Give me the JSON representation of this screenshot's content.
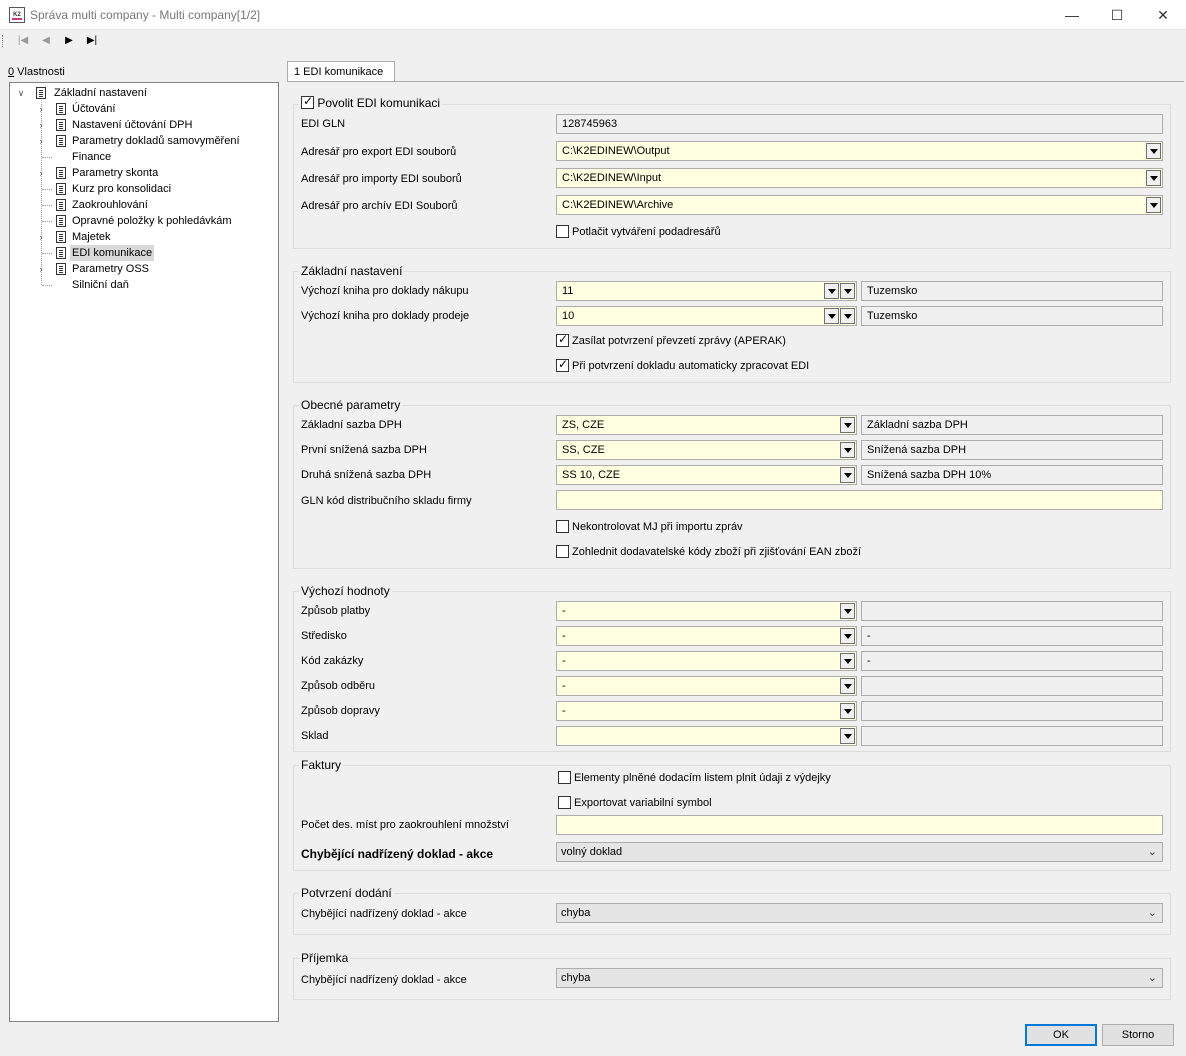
{
  "window": {
    "title": "Správa multi company - Multi company[1/2]",
    "app_icon_text": "K2"
  },
  "left": {
    "label_accel": "0",
    "label_rest": " Vlastnosti",
    "tree": {
      "root": "Základní nastavení",
      "items": [
        "Účtování",
        "Nastavení účtování DPH",
        "Parametry dokladů samovyměření",
        "Finance",
        "Parametry skonta",
        "Kurz pro konsolidaci",
        "Zaokrouhlování",
        "Opravné položky k pohledávkám",
        "Majetek",
        "EDI komunikace",
        "Parametry OSS",
        "Silniční daň"
      ]
    }
  },
  "tab": {
    "label": "1 EDI komunikace"
  },
  "edi": {
    "enable_label": "Povolit EDI komunikaci",
    "gln_label": "EDI GLN",
    "gln_value": "128745963",
    "export_label": "Adresář pro export EDI souborů",
    "export_value": "C:\\K2EDINEW\\Output",
    "import_label": "Adresář pro importy EDI souborů",
    "import_value": "C:\\K2EDINEW\\Input",
    "archive_label": "Adresář pro archív EDI Souborů",
    "archive_value": "C:\\K2EDINEW\\Archive",
    "suppress_label": "Potlačit vytváření podadresářů"
  },
  "basic": {
    "title": "Základní nastavení",
    "purchase_label": "Výchozí kniha pro doklady nákupu",
    "purchase_value": "11",
    "purchase_desc": "Tuzemsko",
    "sale_label": "Výchozí kniha pro doklady prodeje",
    "sale_value": "10",
    "sale_desc": "Tuzemsko",
    "aperak_label": "Zasílat potvrzení převzetí zprávy (APERAK)",
    "auto_label": "Při potvrzení dokladu automaticky zpracovat EDI"
  },
  "general": {
    "title": "Obecné parametry",
    "vat_basic_label": "Základní sazba DPH",
    "vat_basic_value": "ZS, CZE",
    "vat_basic_desc": "Základní sazba DPH",
    "vat_first_label": "První snížená sazba DPH",
    "vat_first_value": "SS, CZE",
    "vat_first_desc": "Snížená sazba DPH",
    "vat_second_label": "Druhá snížená sazba DPH",
    "vat_second_value": "SS 10, CZE",
    "vat_second_desc": "Snížená sazba DPH 10%",
    "gln_wh_label": "GLN kód distribučního skladu firmy",
    "nocheck_label": "Nekontrolovat MJ při importu zpráv",
    "supplier_codes_label": "Zohlednit dodavatelské kódy zboží při zjišťování EAN zboží"
  },
  "defaults": {
    "title": "Výchozí hodnoty",
    "rows": [
      {
        "label": "Způsob platby",
        "value": "-",
        "desc": ""
      },
      {
        "label": "Středisko",
        "value": "-",
        "desc": "-"
      },
      {
        "label": "Kód zakázky",
        "value": "-",
        "desc": "-"
      },
      {
        "label": "Způsob odběru",
        "value": "-",
        "desc": ""
      },
      {
        "label": "Způsob dopravy",
        "value": "-",
        "desc": ""
      },
      {
        "label": "Sklad",
        "value": "",
        "desc": ""
      }
    ]
  },
  "invoices": {
    "title": "Faktury",
    "elements_label": "Elementy plněné dodacím listem plnit údaji z výdejky",
    "export_vs_label": "Exportovat variabilní symbol",
    "decimals_label": "Počet des. míst pro zaokrouhlení množství",
    "missing_label": "Chybějící nadřízený doklad - akce",
    "missing_value": "volný doklad"
  },
  "delivery": {
    "title": "Potvrzení dodání",
    "missing_label": "Chybějící nadřízený doklad - akce",
    "missing_value": "chyba"
  },
  "receipt": {
    "title": "Příjemka",
    "missing_label": "Chybějící nadřízený doklad - akce",
    "missing_value": "chyba"
  },
  "buttons": {
    "ok": "OK",
    "cancel": "Storno"
  },
  "nav": {
    "first": "|◀",
    "prev": "◀",
    "next": "▶",
    "last": "▶|"
  }
}
